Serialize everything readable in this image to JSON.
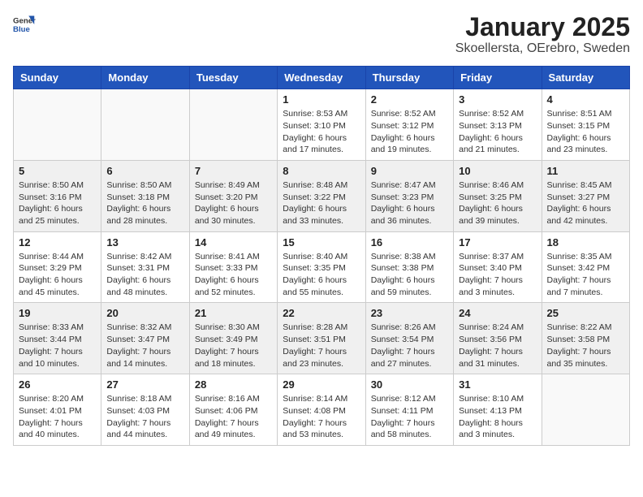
{
  "logo": {
    "general": "General",
    "blue": "Blue"
  },
  "title": "January 2025",
  "subtitle": "Skoellersta, OErebro, Sweden",
  "headers": [
    "Sunday",
    "Monday",
    "Tuesday",
    "Wednesday",
    "Thursday",
    "Friday",
    "Saturday"
  ],
  "weeks": [
    [
      {
        "day": "",
        "sunrise": "",
        "sunset": "",
        "daylight": ""
      },
      {
        "day": "",
        "sunrise": "",
        "sunset": "",
        "daylight": ""
      },
      {
        "day": "",
        "sunrise": "",
        "sunset": "",
        "daylight": ""
      },
      {
        "day": "1",
        "sunrise": "Sunrise: 8:53 AM",
        "sunset": "Sunset: 3:10 PM",
        "daylight": "Daylight: 6 hours and 17 minutes."
      },
      {
        "day": "2",
        "sunrise": "Sunrise: 8:52 AM",
        "sunset": "Sunset: 3:12 PM",
        "daylight": "Daylight: 6 hours and 19 minutes."
      },
      {
        "day": "3",
        "sunrise": "Sunrise: 8:52 AM",
        "sunset": "Sunset: 3:13 PM",
        "daylight": "Daylight: 6 hours and 21 minutes."
      },
      {
        "day": "4",
        "sunrise": "Sunrise: 8:51 AM",
        "sunset": "Sunset: 3:15 PM",
        "daylight": "Daylight: 6 hours and 23 minutes."
      }
    ],
    [
      {
        "day": "5",
        "sunrise": "Sunrise: 8:50 AM",
        "sunset": "Sunset: 3:16 PM",
        "daylight": "Daylight: 6 hours and 25 minutes."
      },
      {
        "day": "6",
        "sunrise": "Sunrise: 8:50 AM",
        "sunset": "Sunset: 3:18 PM",
        "daylight": "Daylight: 6 hours and 28 minutes."
      },
      {
        "day": "7",
        "sunrise": "Sunrise: 8:49 AM",
        "sunset": "Sunset: 3:20 PM",
        "daylight": "Daylight: 6 hours and 30 minutes."
      },
      {
        "day": "8",
        "sunrise": "Sunrise: 8:48 AM",
        "sunset": "Sunset: 3:22 PM",
        "daylight": "Daylight: 6 hours and 33 minutes."
      },
      {
        "day": "9",
        "sunrise": "Sunrise: 8:47 AM",
        "sunset": "Sunset: 3:23 PM",
        "daylight": "Daylight: 6 hours and 36 minutes."
      },
      {
        "day": "10",
        "sunrise": "Sunrise: 8:46 AM",
        "sunset": "Sunset: 3:25 PM",
        "daylight": "Daylight: 6 hours and 39 minutes."
      },
      {
        "day": "11",
        "sunrise": "Sunrise: 8:45 AM",
        "sunset": "Sunset: 3:27 PM",
        "daylight": "Daylight: 6 hours and 42 minutes."
      }
    ],
    [
      {
        "day": "12",
        "sunrise": "Sunrise: 8:44 AM",
        "sunset": "Sunset: 3:29 PM",
        "daylight": "Daylight: 6 hours and 45 minutes."
      },
      {
        "day": "13",
        "sunrise": "Sunrise: 8:42 AM",
        "sunset": "Sunset: 3:31 PM",
        "daylight": "Daylight: 6 hours and 48 minutes."
      },
      {
        "day": "14",
        "sunrise": "Sunrise: 8:41 AM",
        "sunset": "Sunset: 3:33 PM",
        "daylight": "Daylight: 6 hours and 52 minutes."
      },
      {
        "day": "15",
        "sunrise": "Sunrise: 8:40 AM",
        "sunset": "Sunset: 3:35 PM",
        "daylight": "Daylight: 6 hours and 55 minutes."
      },
      {
        "day": "16",
        "sunrise": "Sunrise: 8:38 AM",
        "sunset": "Sunset: 3:38 PM",
        "daylight": "Daylight: 6 hours and 59 minutes."
      },
      {
        "day": "17",
        "sunrise": "Sunrise: 8:37 AM",
        "sunset": "Sunset: 3:40 PM",
        "daylight": "Daylight: 7 hours and 3 minutes."
      },
      {
        "day": "18",
        "sunrise": "Sunrise: 8:35 AM",
        "sunset": "Sunset: 3:42 PM",
        "daylight": "Daylight: 7 hours and 7 minutes."
      }
    ],
    [
      {
        "day": "19",
        "sunrise": "Sunrise: 8:33 AM",
        "sunset": "Sunset: 3:44 PM",
        "daylight": "Daylight: 7 hours and 10 minutes."
      },
      {
        "day": "20",
        "sunrise": "Sunrise: 8:32 AM",
        "sunset": "Sunset: 3:47 PM",
        "daylight": "Daylight: 7 hours and 14 minutes."
      },
      {
        "day": "21",
        "sunrise": "Sunrise: 8:30 AM",
        "sunset": "Sunset: 3:49 PM",
        "daylight": "Daylight: 7 hours and 18 minutes."
      },
      {
        "day": "22",
        "sunrise": "Sunrise: 8:28 AM",
        "sunset": "Sunset: 3:51 PM",
        "daylight": "Daylight: 7 hours and 23 minutes."
      },
      {
        "day": "23",
        "sunrise": "Sunrise: 8:26 AM",
        "sunset": "Sunset: 3:54 PM",
        "daylight": "Daylight: 7 hours and 27 minutes."
      },
      {
        "day": "24",
        "sunrise": "Sunrise: 8:24 AM",
        "sunset": "Sunset: 3:56 PM",
        "daylight": "Daylight: 7 hours and 31 minutes."
      },
      {
        "day": "25",
        "sunrise": "Sunrise: 8:22 AM",
        "sunset": "Sunset: 3:58 PM",
        "daylight": "Daylight: 7 hours and 35 minutes."
      }
    ],
    [
      {
        "day": "26",
        "sunrise": "Sunrise: 8:20 AM",
        "sunset": "Sunset: 4:01 PM",
        "daylight": "Daylight: 7 hours and 40 minutes."
      },
      {
        "day": "27",
        "sunrise": "Sunrise: 8:18 AM",
        "sunset": "Sunset: 4:03 PM",
        "daylight": "Daylight: 7 hours and 44 minutes."
      },
      {
        "day": "28",
        "sunrise": "Sunrise: 8:16 AM",
        "sunset": "Sunset: 4:06 PM",
        "daylight": "Daylight: 7 hours and 49 minutes."
      },
      {
        "day": "29",
        "sunrise": "Sunrise: 8:14 AM",
        "sunset": "Sunset: 4:08 PM",
        "daylight": "Daylight: 7 hours and 53 minutes."
      },
      {
        "day": "30",
        "sunrise": "Sunrise: 8:12 AM",
        "sunset": "Sunset: 4:11 PM",
        "daylight": "Daylight: 7 hours and 58 minutes."
      },
      {
        "day": "31",
        "sunrise": "Sunrise: 8:10 AM",
        "sunset": "Sunset: 4:13 PM",
        "daylight": "Daylight: 8 hours and 3 minutes."
      },
      {
        "day": "",
        "sunrise": "",
        "sunset": "",
        "daylight": ""
      }
    ]
  ]
}
